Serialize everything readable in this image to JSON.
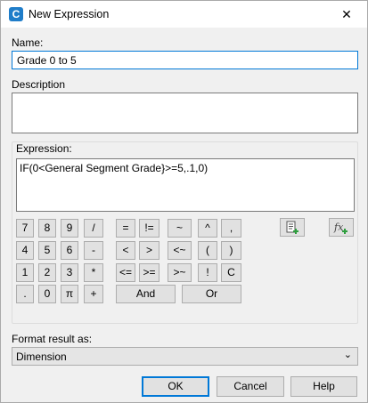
{
  "window": {
    "title": "New Expression",
    "app_icon_letter": "C"
  },
  "name": {
    "label": "Name:",
    "value": "Grade 0 to 5"
  },
  "description": {
    "label": "Description",
    "value": ""
  },
  "expression": {
    "label": "Expression:",
    "value": "IF(0<General Segment Grade}>=5,.1,0)"
  },
  "calculator": {
    "row1": [
      "7",
      "8",
      "9",
      "/",
      "=",
      "!=",
      "~",
      "^",
      ","
    ],
    "row2": [
      "4",
      "5",
      "6",
      "-",
      "<",
      ">",
      "<~",
      "(",
      ")"
    ],
    "row3": [
      "1",
      "2",
      "3",
      "*",
      "<=",
      ">=",
      ">~",
      "!",
      "C"
    ],
    "row4": [
      ".",
      "0",
      "π",
      "+",
      "And",
      "Or"
    ]
  },
  "tools": {
    "insert_property_icon": "insert-property-icon",
    "insert_function_icon": "insert-function-icon"
  },
  "format": {
    "label": "Format result as:",
    "selected": "Dimension"
  },
  "buttons": {
    "ok": "OK",
    "cancel": "Cancel",
    "help": "Help"
  }
}
